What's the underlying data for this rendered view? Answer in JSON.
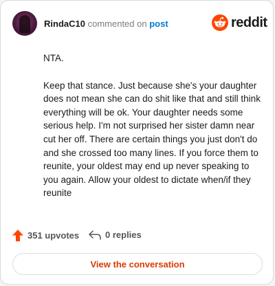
{
  "header": {
    "username": "RindaC10",
    "action_text": "commented on",
    "post_link": "post",
    "brand": "reddit"
  },
  "comment": {
    "paragraphs": [
      "NTA.",
      "Keep that stance. Just because she's your daughter does not mean she can do shit like that and still think everything will be ok. Your daughter needs some serious help. I'm not surprised her sister damn near cut her off. There are certain things you just don't do and she crossed too many lines. If you force them to reunite, your oldest may end up never speaking to you again. Allow your oldest to dictate when/if they reunite"
    ]
  },
  "footer": {
    "upvotes": "351 upvotes",
    "replies": "0 replies"
  },
  "cta": {
    "label": "View the conversation"
  },
  "colors": {
    "brand": "#ff4500",
    "link": "#0079d3",
    "cta_text": "#d93a00"
  },
  "icons": {
    "avatar": "user-avatar",
    "logo": "reddit-snoo-icon",
    "upvote": "upvote-arrow-icon",
    "reply": "reply-arrow-icon"
  }
}
